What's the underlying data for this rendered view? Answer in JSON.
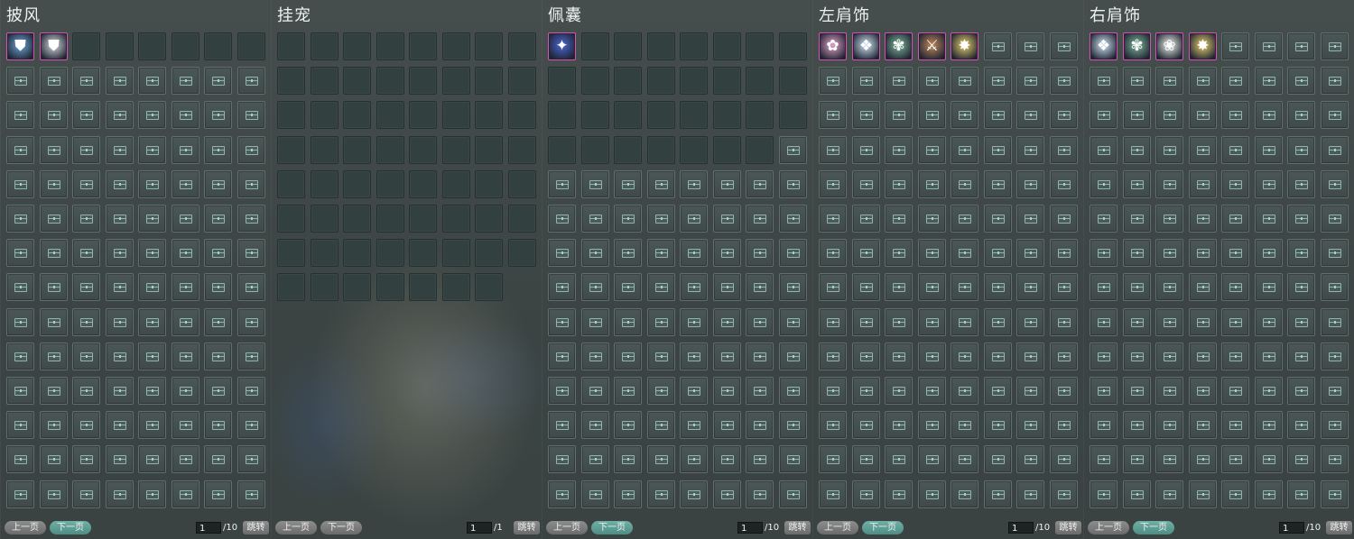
{
  "panels": [
    {
      "title": "披风",
      "items": [
        {
          "icon": "blue-cape-icon",
          "glyph": "⛊",
          "color": "#6fa7d8"
        },
        {
          "icon": "white-cape-icon",
          "glyph": "⛊",
          "color": "#d9dde0"
        }
      ],
      "unlocked_empty": 6,
      "locked": 104,
      "pagination": {
        "prev": "上一页",
        "next": "下一页",
        "page": "1",
        "total": "/10",
        "jump": "跳转",
        "next_active": true
      }
    },
    {
      "title": "挂宠",
      "items": [],
      "unlocked_empty": 63,
      "locked": 0,
      "pagination": {
        "prev": "上一页",
        "next": "下一页",
        "page": "1",
        "total": "/1",
        "jump": "跳转",
        "next_active": false
      }
    },
    {
      "title": "佩囊",
      "items": [
        {
          "icon": "blue-pouch-icon",
          "glyph": "✦",
          "color": "#4b67d1"
        }
      ],
      "unlocked_empty": 30,
      "locked": 81,
      "pagination": {
        "prev": "上一页",
        "next": "下一页",
        "page": "1",
        "total": "/10",
        "jump": "跳转",
        "next_active": true
      }
    },
    {
      "title": "左肩饰",
      "items": [
        {
          "icon": "pink-flower-shoulder-icon",
          "glyph": "✿",
          "color": "#e4a3c8"
        },
        {
          "icon": "white-wing-shoulder-icon",
          "glyph": "❖",
          "color": "#cfe4f2"
        },
        {
          "icon": "green-lotus-shoulder-icon",
          "glyph": "✾",
          "color": "#7fb59a"
        },
        {
          "icon": "bronze-blade-shoulder-icon",
          "glyph": "⚔",
          "color": "#c0885a"
        },
        {
          "icon": "gold-star-shoulder-icon",
          "glyph": "✸",
          "color": "#e7cf6d"
        }
      ],
      "unlocked_empty": 0,
      "locked": 107,
      "pagination": {
        "prev": "上一页",
        "next": "下一页",
        "page": "1",
        "total": "/10",
        "jump": "跳转",
        "next_active": true
      }
    },
    {
      "title": "右肩饰",
      "items": [
        {
          "icon": "white-wing-shoulder-icon",
          "glyph": "❖",
          "color": "#cfe4f2"
        },
        {
          "icon": "green-lotus-shoulder-icon",
          "glyph": "✾",
          "color": "#7fb59a"
        },
        {
          "icon": "white-flower-shoulder-icon",
          "glyph": "❀",
          "color": "#eef2ea"
        },
        {
          "icon": "gold-star-shoulder-icon",
          "glyph": "✸",
          "color": "#e7cf6d"
        }
      ],
      "unlocked_empty": 0,
      "locked": 108,
      "pagination": {
        "prev": "上一页",
        "next": "下一页",
        "page": "1",
        "total": "/10",
        "jump": "跳转",
        "next_active": true
      }
    }
  ]
}
